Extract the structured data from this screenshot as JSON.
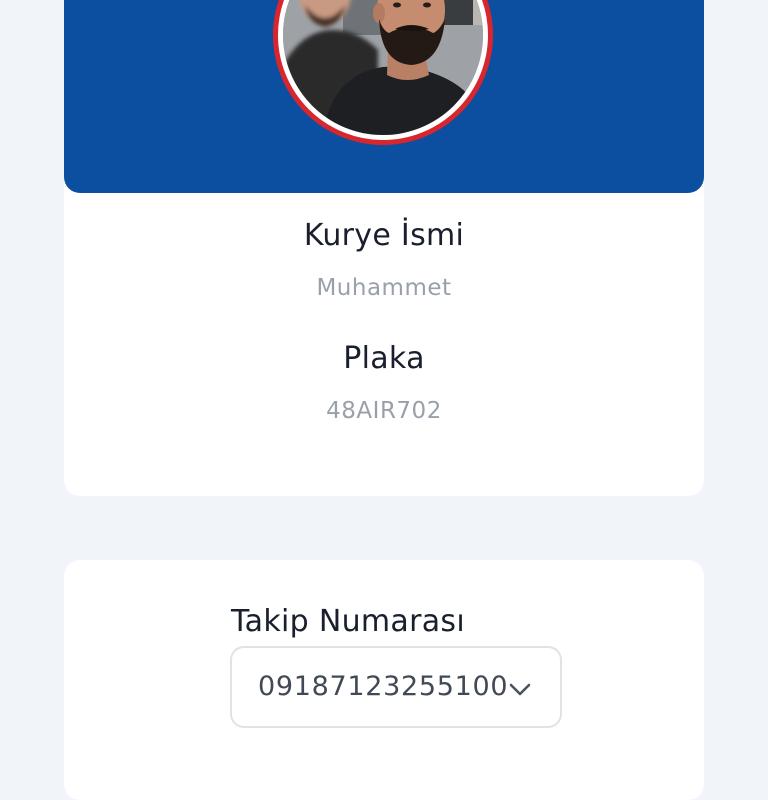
{
  "profile": {
    "avatar_icon": "courier-photo",
    "border_color": "#d8262e",
    "header_color": "#0c4fa0",
    "courier_name_label": "Kurye İsmi",
    "courier_name_value": "Muhammet",
    "plate_label": "Plaka",
    "plate_value": "48AIR702"
  },
  "tracking": {
    "label": "Takip Numarası",
    "selected_value": "09187123255100",
    "dropdown_icon": "chevron-down-icon"
  }
}
